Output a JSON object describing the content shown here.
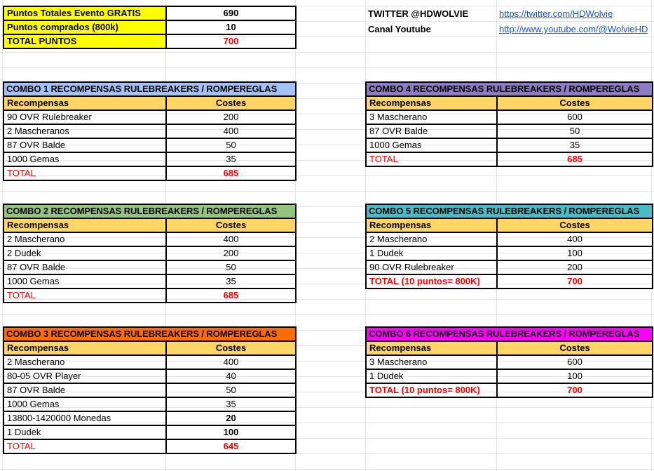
{
  "summary": {
    "rows": [
      {
        "label": "Puntos Totales Evento GRATIS",
        "value": "690"
      },
      {
        "label": "Puntos comprados (800k)",
        "value": "10"
      },
      {
        "label": "TOTAL PUNTOS",
        "value": "700"
      }
    ]
  },
  "social": {
    "twitter_label": "TWITTER @HDWOLVIE",
    "twitter_url": "https://twitter.com/HDWolvie",
    "youtube_label": "Canal Youtube",
    "youtube_url": "http://www.youtube.com/@WolvieHD"
  },
  "headers": {
    "col1": "Recompensas",
    "col2": "Costes"
  },
  "colors": {
    "combo1": "#a4c2f4",
    "combo2": "#93c47d",
    "combo3": "#ff6d01",
    "combo4": "#8e7cc3",
    "combo5": "#46bdc6",
    "combo6": "#ff00ff",
    "header": "#ffd666",
    "summary": "#ffff00",
    "total": "#ff0000"
  },
  "combos": [
    {
      "title": "COMBO 1 RECOMPENSAS RULEBREAKERS / ROMPEREGLAS",
      "rows": [
        {
          "name": "90 OVR Rulebreaker",
          "cost": "200"
        },
        {
          "name": "2 Mascheranos",
          "cost": "400"
        },
        {
          "name": "87 OVR Balde",
          "cost": "50"
        },
        {
          "name": "1000 Gemas",
          "cost": "35"
        }
      ],
      "total_label": "TOTAL",
      "total": "685"
    },
    {
      "title": "COMBO 2 RECOMPENSAS RULEBREAKERS / ROMPEREGLAS",
      "rows": [
        {
          "name": "2 Mascherano",
          "cost": "400"
        },
        {
          "name": "2 Dudek",
          "cost": "200"
        },
        {
          "name": "87 OVR Balde",
          "cost": "50"
        },
        {
          "name": "1000 Gemas",
          "cost": "35"
        }
      ],
      "total_label": "TOTAL",
      "total": "685"
    },
    {
      "title": "COMBO 3 RECOMPENSAS RULEBREAKERS / ROMPEREGLAS",
      "rows": [
        {
          "name": "2 Mascherano",
          "cost": "400"
        },
        {
          "name": "80-05 OVR Player",
          "cost": "40"
        },
        {
          "name": "87 OVR Balde",
          "cost": "50"
        },
        {
          "name": "1000 Gemas",
          "cost": "35"
        },
        {
          "name": "13800-1420000 Monedas",
          "cost": "20"
        },
        {
          "name": "1 Dudek",
          "cost": "100"
        }
      ],
      "total_label": "TOTAL",
      "total": "645"
    },
    {
      "title": "COMBO 4 RECOMPENSAS RULEBREAKERS / ROMPEREGLAS",
      "rows": [
        {
          "name": "3 Mascherano",
          "cost": "600"
        },
        {
          "name": "87 OVR Balde",
          "cost": "50"
        },
        {
          "name": "1000 Gemas",
          "cost": "35"
        }
      ],
      "total_label": "TOTAL",
      "total": "685"
    },
    {
      "title": "COMBO 5 RECOMPENSAS RULEBREAKERS / ROMPEREGLAS",
      "rows": [
        {
          "name": "2 Mascherano",
          "cost": "400"
        },
        {
          "name": "1 Dudek",
          "cost": "100"
        },
        {
          "name": "90 OVR Rulebreaker",
          "cost": "200"
        }
      ],
      "total_label": "TOTAL (10 puntos= 800K)",
      "total": "700"
    },
    {
      "title": "COMBO 6 RECOMPENSAS RULEBREAKERS / ROMPEREGLAS",
      "rows": [
        {
          "name": "3 Mascherano",
          "cost": "600"
        },
        {
          "name": "1 Dudek",
          "cost": "100"
        }
      ],
      "total_label": "TOTAL (10 puntos= 800K)",
      "total": "700"
    }
  ]
}
